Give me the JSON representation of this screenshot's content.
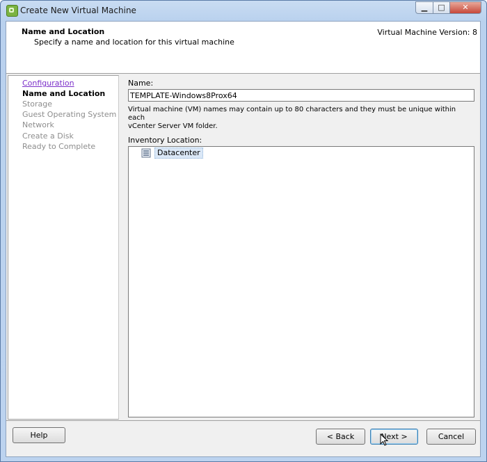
{
  "window": {
    "title": "Create New Virtual Machine",
    "controls": {
      "minimize": "▁",
      "maximize": "□",
      "close": "✕"
    }
  },
  "header": {
    "title": "Name and Location",
    "subtitle": "Specify a name and location for this virtual machine",
    "version": "Virtual Machine Version: 8"
  },
  "steps": [
    {
      "label": "Configuration",
      "state": "link"
    },
    {
      "label": "Name and Location",
      "state": "current"
    },
    {
      "label": "Storage",
      "state": "disabled"
    },
    {
      "label": "Guest Operating System",
      "state": "disabled"
    },
    {
      "label": "Network",
      "state": "disabled"
    },
    {
      "label": "Create a Disk",
      "state": "disabled"
    },
    {
      "label": "Ready to Complete",
      "state": "disabled"
    }
  ],
  "form": {
    "name_label": "Name:",
    "name_value": "TEMPLATE-Windows8Prox64",
    "hint_line1": "Virtual machine (VM) names may contain up to 80 characters and they must be unique within each",
    "hint_line2": "vCenter Server VM folder.",
    "inventory_label": "Inventory Location:",
    "inventory_tree": [
      {
        "label": "Datacenter",
        "icon": "datacenter-icon",
        "selected": true
      }
    ]
  },
  "buttons": {
    "help": "Help",
    "back": "< Back",
    "next": "Next >",
    "cancel": "Cancel"
  },
  "colors": {
    "link": "#7b2fc9",
    "disabled_step": "#8d8d8d",
    "selection": "#dbe8f7"
  }
}
